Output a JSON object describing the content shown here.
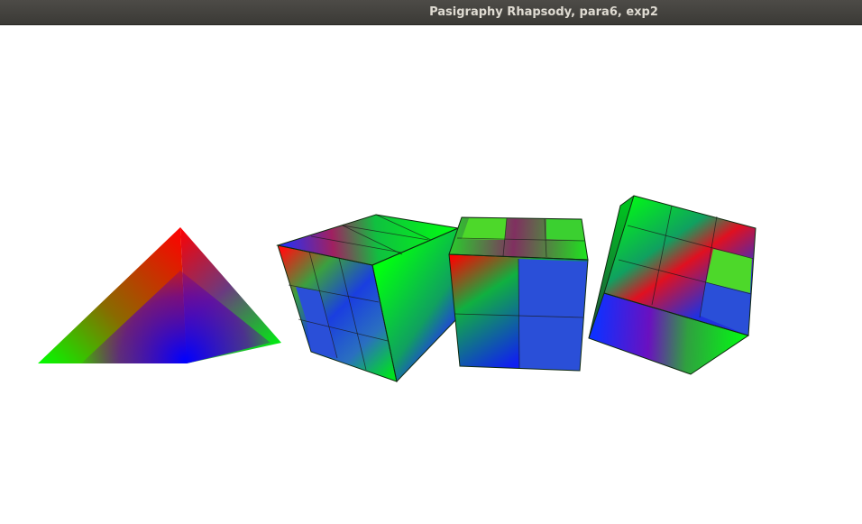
{
  "window": {
    "title": "Pasigraphy Rhapsody, para6, exp2"
  },
  "scene": {
    "objects": [
      "pyramid",
      "cube",
      "cube",
      "cube"
    ],
    "colors": {
      "red": "#ff0000",
      "green": "#00ff00",
      "blue": "#1010ee",
      "flat_blue": "#2a4fd8",
      "flat_green": "#4dd82a",
      "background": "#ffffff"
    }
  }
}
